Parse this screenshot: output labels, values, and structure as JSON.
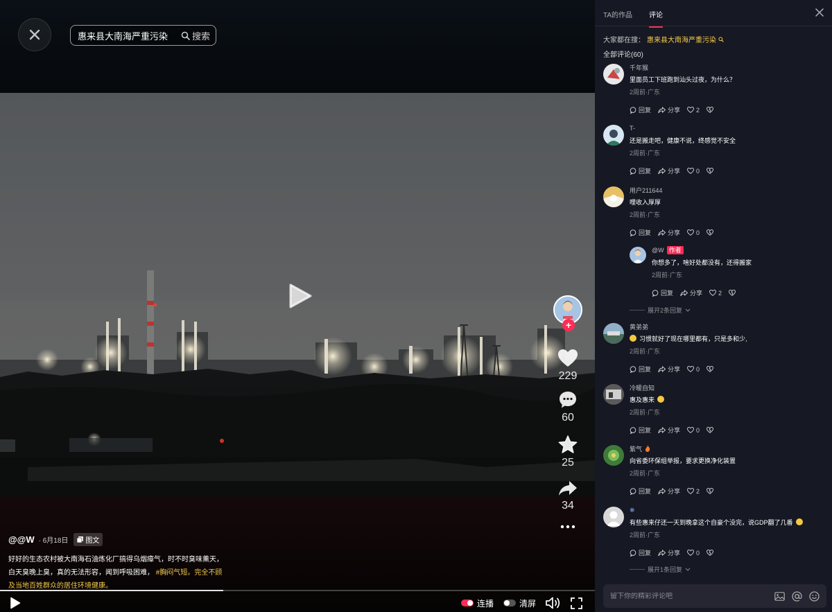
{
  "search": {
    "value": "惠来县大南海严重污染",
    "button_label": "搜索"
  },
  "video": {
    "likes": "229",
    "comments": "60",
    "favorites": "25",
    "shares": "34",
    "progress_fraction": 0.375
  },
  "caption": {
    "author": "@@W",
    "date": "· 6月18日",
    "tag": "图文",
    "text": "好好的生态农村被大南海石油炼化厂搞得乌烟瘴气，时不时臭味薰天，白天臭晚上臭，真的无法形容，闻到呼吸困难，",
    "hashtag": "#胸闷气短。",
    "text_yellow": "完全不顾及当地百姓群众的居住环境健康。"
  },
  "controls": {
    "autoplay_label": "连播",
    "clear_label": "清屏"
  },
  "panel": {
    "tabs": [
      "TA的作品",
      "评论"
    ],
    "hot_prefix": "大家都在搜：",
    "hot_query": "惠来县大南海严重污染",
    "all_comments": "全部评论(60)",
    "input_placeholder": "留下你的精彩评论吧"
  },
  "ops": {
    "reply": "回复",
    "share": "分享"
  },
  "comments": [
    {
      "name": "千年猴",
      "text": "里面员工下班跑到汕头过夜，为什么？",
      "meta": "2周前·广东",
      "likes": "2"
    },
    {
      "name": "T-",
      "text": "还是搬走吧，健康不说，终感觉不安全",
      "meta": "2周前·广东",
      "likes": "0"
    },
    {
      "name": "用户211644",
      "text": "哩收入厚厚",
      "meta": "2周前·广东",
      "likes": "0"
    },
    {
      "name": "@W",
      "badge": "作者",
      "text": "你想多了，啥好处都没有，还得搬家",
      "meta": "2周前·广东",
      "likes": "2"
    },
    {
      "name": "黄弟弟",
      "text": "习惯就好了现在哪里都有，只是多和少,",
      "meta": "2周前·广东",
      "likes": "0"
    },
    {
      "name": "冷暖自知",
      "text": "惠及惠来",
      "meta": "2周前·广东",
      "likes": "0"
    },
    {
      "name": "紫气",
      "text": "向省委环保组举报，要求更换净化装置",
      "meta": "2周前·广东",
      "likes": "2"
    },
    {
      "name": "❄",
      "text": "有些惠来仔还一天到晚拿这个自豪个没完，说GDP翻了几番",
      "meta": "2周前·广东",
      "likes": "0"
    }
  ],
  "expand": [
    "展开2条回复",
    "展开1条回复"
  ],
  "colors": {
    "accent": "#fe2c55",
    "hashtag": "#f2c94c",
    "panel_bg": "#161823"
  }
}
